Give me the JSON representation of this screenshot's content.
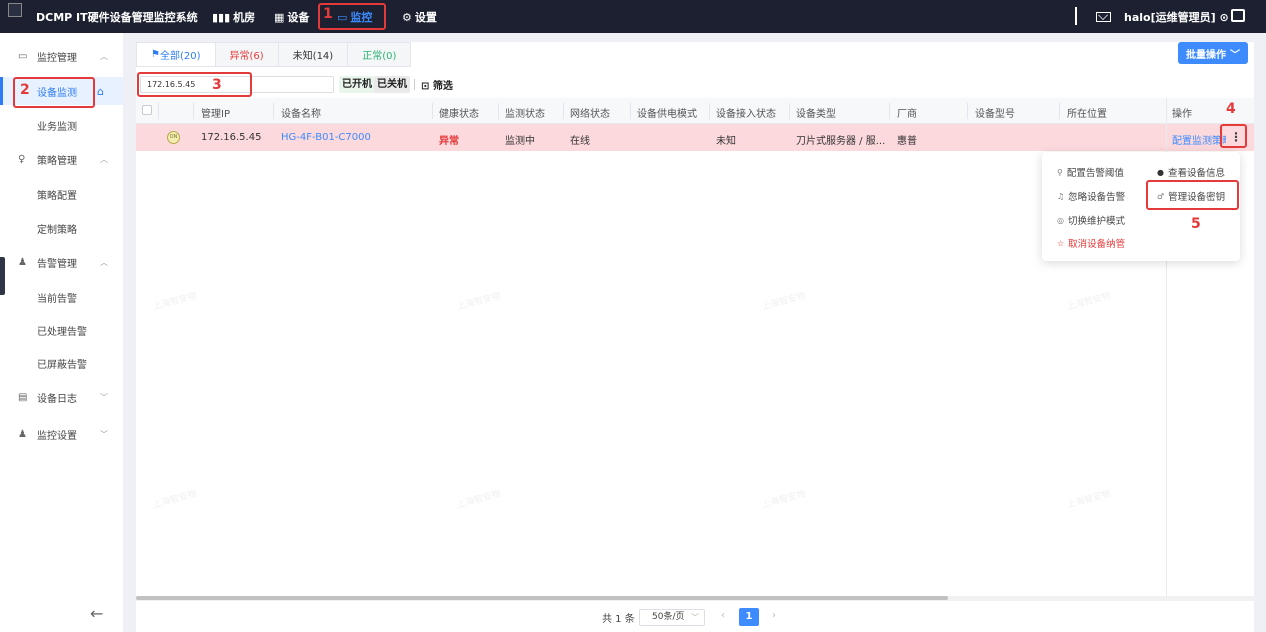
{
  "app": {
    "title": "DCMP IT硬件设备管理监控系统"
  },
  "nav": [
    {
      "label": "机房",
      "icon": "bar-chart-icon"
    },
    {
      "label": "设备",
      "icon": "grid-icon"
    },
    {
      "label": "监控",
      "icon": "monitor-icon",
      "active": true
    },
    {
      "label": "设置",
      "icon": "gear-icon"
    }
  ],
  "user": {
    "name": "halo[运维管理员]"
  },
  "sidebar": {
    "groups": [
      {
        "label": "监控管理",
        "icon": "monitor-icon",
        "items": [
          "设备监测",
          "业务监测"
        ]
      },
      {
        "label": "策略管理",
        "icon": "bulb-icon",
        "items": [
          "策略配置",
          "定制策略"
        ]
      },
      {
        "label": "告警管理",
        "icon": "bell-icon",
        "items": [
          "当前告警",
          "已处理告警",
          "已屏蔽告警"
        ]
      },
      {
        "label": "设备日志",
        "icon": "document-icon",
        "items": []
      },
      {
        "label": "监控设置",
        "icon": "bell-icon",
        "items": []
      }
    ],
    "active_item": "设备监测"
  },
  "tabs": [
    "全部(20)",
    "异常(6)",
    "未知(14)",
    "正常(0)"
  ],
  "batch_button": "批量操作",
  "search": {
    "value": "172.16.5.45"
  },
  "filters": {
    "powered_on": "已开机",
    "powered_off": "已关机",
    "filter_label": "筛选"
  },
  "table": {
    "headers": [
      "管理IP",
      "设备名称",
      "健康状态",
      "监测状态",
      "网络状态",
      "设备供电模式",
      "设备接入状态",
      "设备类型",
      "厂商",
      "设备型号",
      "所在位置",
      "操作"
    ],
    "rows": [
      {
        "power_badge": "ON",
        "ip": "172.16.5.45",
        "name": "HG-4F-B01-C7000",
        "health": "异常",
        "monitor": "监测中",
        "network": "在线",
        "power_mode": "",
        "access": "未知",
        "type": "刀片式服务器 / 服...",
        "vendor": "惠普",
        "model": "",
        "location": "",
        "action": "配置监测策略"
      }
    ]
  },
  "dropdown": {
    "left": [
      "配置告警阈值",
      "忽略设备告警",
      "切换维护模式",
      "取消设备纳管"
    ],
    "right": [
      "查看设备信息",
      "管理设备密钥"
    ]
  },
  "annotations": [
    "1",
    "2",
    "3",
    "4",
    "5"
  ],
  "watermark": "上海智安物",
  "pagination": {
    "total": "共 1 条",
    "page_size": "50条/页",
    "current_page": "1"
  },
  "colors": {
    "accent": "#3d8bfd",
    "danger": "#e53a3a",
    "topbar": "#1c2030",
    "error_row": "#fcd9dc"
  }
}
